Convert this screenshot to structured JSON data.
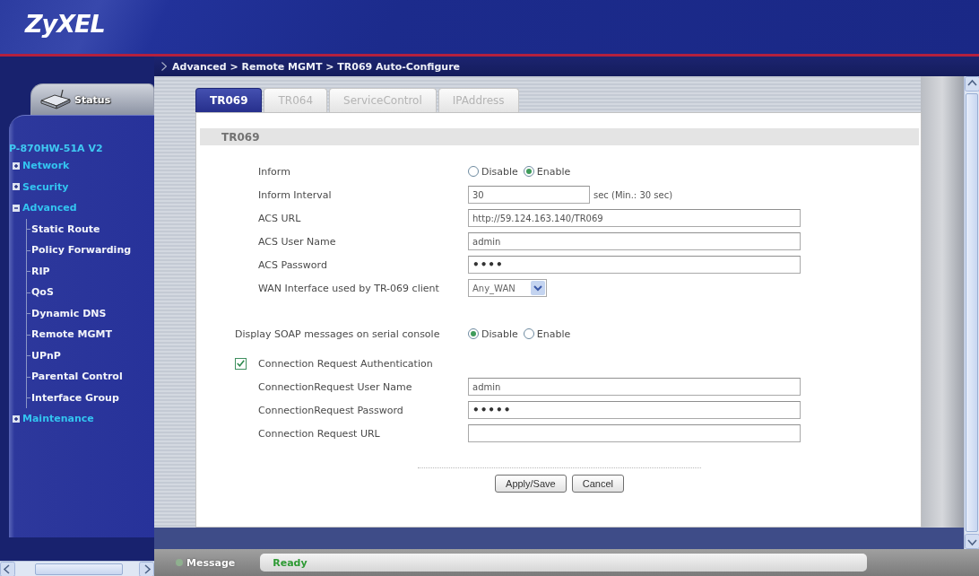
{
  "header": {
    "logo": "ZyXEL"
  },
  "sidebar": {
    "status_tab": "Status",
    "device": "P-870HW-51A V2",
    "items": [
      {
        "label": "Network",
        "expanded": false
      },
      {
        "label": "Security",
        "expanded": false
      },
      {
        "label": "Advanced",
        "expanded": true,
        "children": [
          {
            "label": "Static Route"
          },
          {
            "label": "Policy Forwarding"
          },
          {
            "label": "RIP"
          },
          {
            "label": "QoS"
          },
          {
            "label": "Dynamic DNS"
          },
          {
            "label": "Remote MGMT"
          },
          {
            "label": "UPnP"
          },
          {
            "label": "Parental Control"
          },
          {
            "label": "Interface Group"
          }
        ]
      },
      {
        "label": "Maintenance",
        "expanded": false
      }
    ]
  },
  "breadcrumb": "Advanced > Remote MGMT > TR069 Auto-Configure",
  "tabs": [
    {
      "label": "TR069",
      "selected": true
    },
    {
      "label": "TR064",
      "selected": false
    },
    {
      "label": "ServiceControl",
      "selected": false
    },
    {
      "label": "IPAddress",
      "selected": false
    }
  ],
  "section": {
    "title": "TR069"
  },
  "form": {
    "rows": [
      {
        "kind": "radio",
        "label": "Inform",
        "options": [
          {
            "label": "Disable",
            "selected": false
          },
          {
            "label": "Enable",
            "selected": true
          }
        ]
      },
      {
        "kind": "number",
        "label": "Inform Interval",
        "value": "30",
        "note": "sec (Min.: 30 sec)"
      },
      {
        "kind": "text",
        "label": "ACS URL",
        "value": "http://59.124.163.140/TR069"
      },
      {
        "kind": "text",
        "label": "ACS User Name",
        "value": "admin"
      },
      {
        "kind": "password",
        "label": "ACS Password",
        "value": "••••"
      },
      {
        "kind": "select",
        "label": "WAN Interface used by TR-069 client",
        "value": "Any_WAN"
      }
    ],
    "soap": {
      "label": "Display SOAP messages on serial console",
      "options": [
        {
          "label": "Disable",
          "selected": true
        },
        {
          "label": "Enable",
          "selected": false
        }
      ]
    },
    "connection_request": {
      "label": "Connection Request Authentication",
      "checked": true,
      "rows": [
        {
          "kind": "text",
          "label": "ConnectionRequest User Name",
          "value": "admin"
        },
        {
          "kind": "password",
          "label": "ConnectionRequest Password",
          "value": "•••••"
        },
        {
          "kind": "text",
          "label": "Connection Request URL"
        }
      ]
    }
  },
  "buttons": [
    "Apply/Save",
    "Cancel"
  ],
  "status_bar": {
    "label": "Message",
    "value": "Ready"
  }
}
